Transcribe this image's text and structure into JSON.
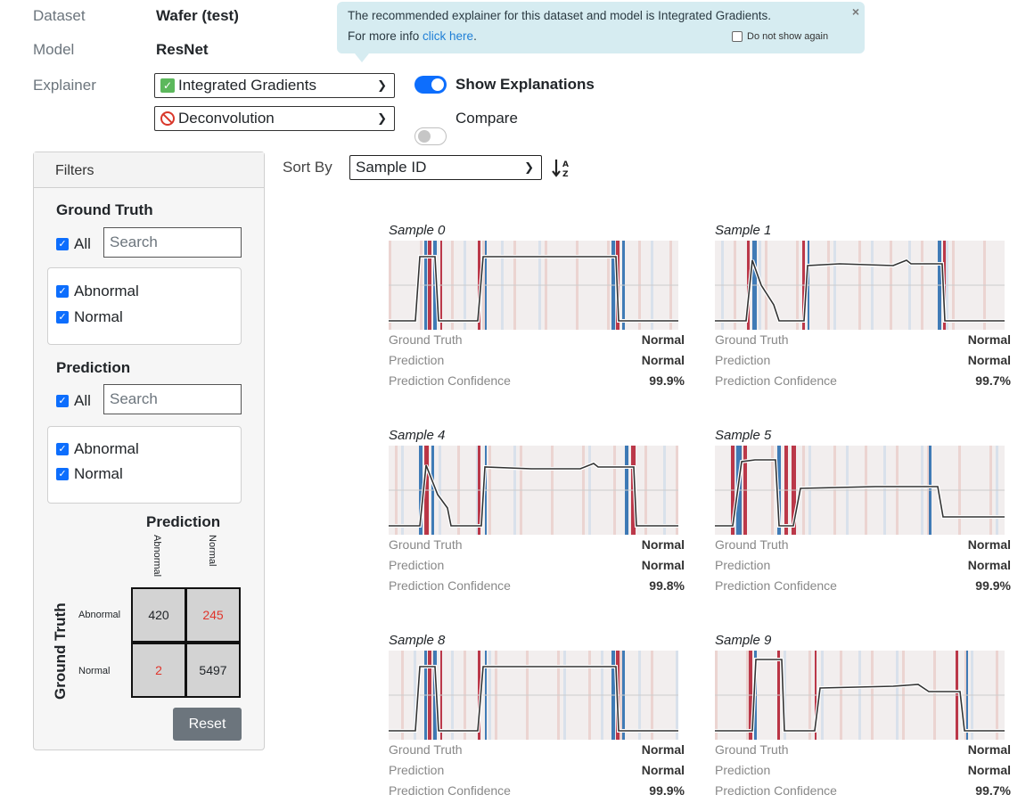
{
  "header": {
    "dataset_label": "Dataset",
    "dataset_value": "Wafer (test)",
    "model_label": "Model",
    "model_value": "ResNet",
    "explainer_label": "Explainer",
    "explainer_primary": "Integrated Gradients",
    "explainer_secondary": "Deconvolution",
    "show_explanations_label": "Show Explanations",
    "compare_label": "Compare"
  },
  "tooltip": {
    "line1": "The recommended explainer for this dataset and model is Integrated Gradients.",
    "line2_prefix": "For more info ",
    "line2_link": "click here",
    "line2_suffix": ".",
    "dont_show": "Do not show again",
    "close": "×"
  },
  "filters": {
    "title": "Filters",
    "ground_truth": {
      "title": "Ground Truth",
      "all_label": "All",
      "search_placeholder": "Search",
      "items": [
        "Abnormal",
        "Normal"
      ]
    },
    "prediction": {
      "title": "Prediction",
      "all_label": "All",
      "search_placeholder": "Search",
      "items": [
        "Abnormal",
        "Normal"
      ]
    },
    "matrix": {
      "col_title": "Prediction",
      "row_title": "Ground Truth",
      "col_labels": [
        "Abnormal",
        "Normal"
      ],
      "row_labels": [
        "Abnormal",
        "Normal"
      ],
      "cells": [
        [
          "420",
          "245"
        ],
        [
          "2",
          "5497"
        ]
      ],
      "error_color": "#e0342b"
    },
    "reset_label": "Reset"
  },
  "sort": {
    "label": "Sort By",
    "value": "Sample ID",
    "icon": "sort-alpha-icon"
  },
  "samples": [
    {
      "title": "Sample 0",
      "ground_truth": "Normal",
      "prediction": "Normal",
      "confidence": "99.9%"
    },
    {
      "title": "Sample 1",
      "ground_truth": "Normal",
      "prediction": "Normal",
      "confidence": "99.7%"
    },
    {
      "title": "Sample 4",
      "ground_truth": "Normal",
      "prediction": "Normal",
      "confidence": "99.8%"
    },
    {
      "title": "Sample 5",
      "ground_truth": "Normal",
      "prediction": "Normal",
      "confidence": "99.9%"
    },
    {
      "title": "Sample 8",
      "ground_truth": "Normal",
      "prediction": "Normal",
      "confidence": "99.9%"
    },
    {
      "title": "Sample 9",
      "ground_truth": "Normal",
      "prediction": "Normal",
      "confidence": "99.7%"
    }
  ],
  "sample_labels": {
    "ground_truth": "Ground Truth",
    "prediction": "Prediction",
    "confidence": "Prediction Confidence"
  },
  "colors": {
    "accent": "#0d6efd",
    "heat_positive": "#b2182b",
    "heat_negative": "#2166ac",
    "tooltip_bg": "#d6ecf1"
  }
}
